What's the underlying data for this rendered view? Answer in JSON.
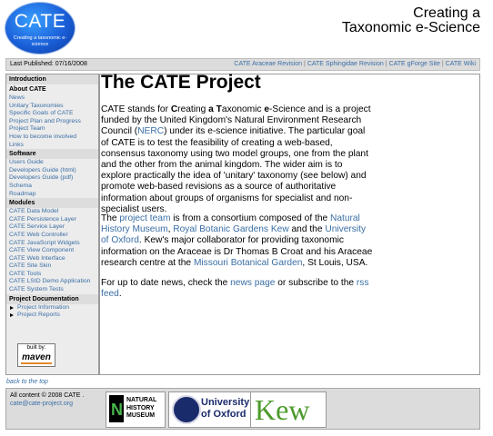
{
  "header": {
    "logo": {
      "title": "CATE",
      "subtitle": "Creating a taxonomic e-science"
    },
    "title_line1": "Creating a",
    "title_line2": "Taxonomic e-Science"
  },
  "topbar": {
    "published": "Last Published: 07/16/2008",
    "links": [
      "CATE Araceae Revision",
      "CATE Sphingidae Revision",
      "CATE gForge Site",
      "CATE Wiki"
    ]
  },
  "sidebar": {
    "sections": [
      {
        "title": "Introduction",
        "items": []
      },
      {
        "title": "About CATE",
        "items": [
          "News",
          "Unitary Taxonomies",
          "Specific Goals of CATE",
          "Project Plan and Progress",
          "Project Team",
          "How to become involved",
          "Links"
        ]
      },
      {
        "title": "Software",
        "items": [
          "Users Guide",
          "Developers Guide (html)",
          "Developers Guide (pdf)",
          "Schema",
          "Roadmap"
        ]
      },
      {
        "title": "Modules",
        "items": [
          "CATE Data Model",
          "CATE Persistence Layer",
          "CATE Service Layer",
          "CATE Web Controller",
          "CATE JavaScript Widgets",
          "CATE View Component",
          "CATE Web Interface",
          "CATE Site Skin",
          "CATE Tools",
          "CATE LSID Demo Application",
          "CATE System Tests"
        ]
      },
      {
        "title": "Project Documentation",
        "items": [
          "Project Information",
          "Project Reports"
        ]
      }
    ],
    "built_by": "built by:",
    "maven": "maven"
  },
  "main": {
    "heading": "The CATE Project",
    "p1": {
      "t1": "CATE stands for ",
      "c1": "C",
      "t2": "reating ",
      "c2": "a",
      "t3": " ",
      "c3": "T",
      "t4": "axonomic ",
      "c4": "e",
      "t5": "-Science and is a project funded by the United Kingdom's Natural Environment Research Council (",
      "nerc": "NERC",
      "t6": ") under its e-science initiative. The particular goal of CATE is to test the feasibility of creating a web-based, consensus taxonomy using two model groups, one from the plant and the other from the animal kingdom. The wider aim is to explore practically the idea of 'unitary' taxonomy (see below) and promote web-based revisions as a source of authoritative information about groups of organisms for specialist and non-specialist users."
    },
    "p2": {
      "t1": "The ",
      "team": "project team",
      "t2": " is from a consortium composed of the ",
      "nhm": "Natural History Museum",
      "t3": ", ",
      "kew": "Royal Botanic Gardens Kew",
      "t4": " and the ",
      "oxford": "University of Oxford",
      "t5": ". Kew's major collaborator for providing taxonomic information on the Araceae is Dr Thomas B Croat and his Araceae research centre at the ",
      "missouri": "Missouri Botanical Garden",
      "t6": ", St Louis, USA."
    },
    "p3": {
      "t1": "For up to date news, check the ",
      "news": "news page",
      "t2": " or subscribe to the ",
      "rss": "rss feed",
      "t3": "."
    }
  },
  "back_to_top": "back to the top",
  "footer": {
    "copyright": "All content © 2008 CATE .",
    "email": "cate@cate-project.org",
    "nhm_logo": "NATURAL HISTORY MUSEUM",
    "oxford_logo_1": "University",
    "oxford_logo_2": "of Oxford",
    "kew_logo": "Kew"
  }
}
